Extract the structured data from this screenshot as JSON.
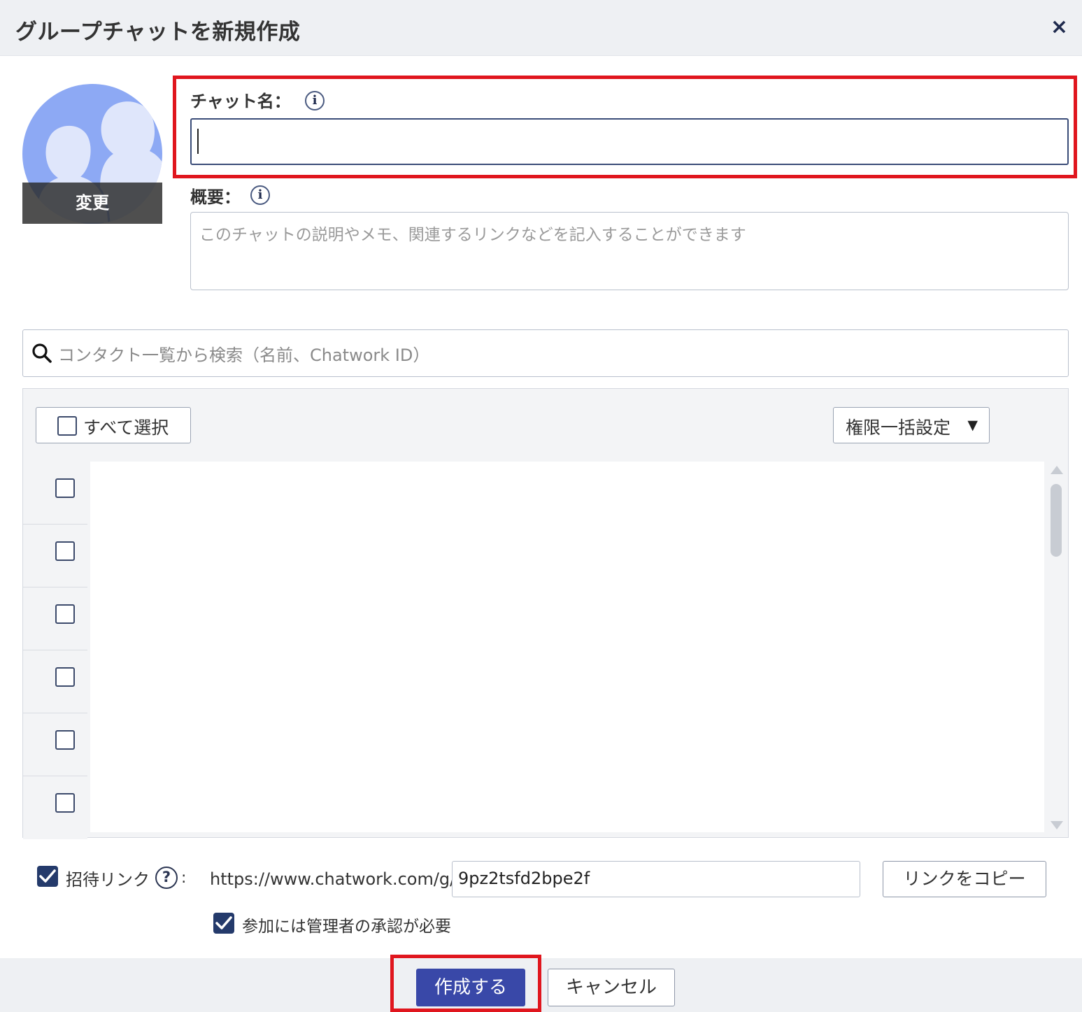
{
  "dialog": {
    "title": "グループチャットを新規作成",
    "close_symbol": "×"
  },
  "avatar": {
    "change_label": "変更",
    "colors": {
      "background": "#8da9f4",
      "silhouette": "#dfe6fb"
    }
  },
  "form": {
    "chat_name_label": "チャット名：",
    "chat_name_value": "",
    "description_label": "概要：",
    "description_placeholder": "このチャットの説明やメモ、関連するリンクなどを記入することができます",
    "info_icon_glyph": "i"
  },
  "contacts": {
    "search_placeholder": "コンタクト一覧から検索（名前、Chatwork ID）",
    "select_all_label": "すべて選択",
    "bulk_permission_label": "権限一括設定",
    "rows": [
      {
        "checked": false
      },
      {
        "checked": false
      },
      {
        "checked": false
      },
      {
        "checked": false
      },
      {
        "checked": false
      },
      {
        "checked": false
      }
    ]
  },
  "invite": {
    "enabled": true,
    "label": "招待リンク",
    "help_glyph": "?",
    "colon": ":",
    "url_prefix": "https://www.chatwork.com/g/",
    "code": "9pz2tsfd2bpe2f",
    "copy_button_label": "リンクをコピー",
    "require_approval": true,
    "require_approval_label": "参加には管理者の承認が必要"
  },
  "footer": {
    "create_label": "作成する",
    "cancel_label": "キャンセル"
  },
  "colors": {
    "highlight": "#e0161e",
    "primary_button": "#3948a8",
    "checkbox_checked": "#243a6b"
  }
}
